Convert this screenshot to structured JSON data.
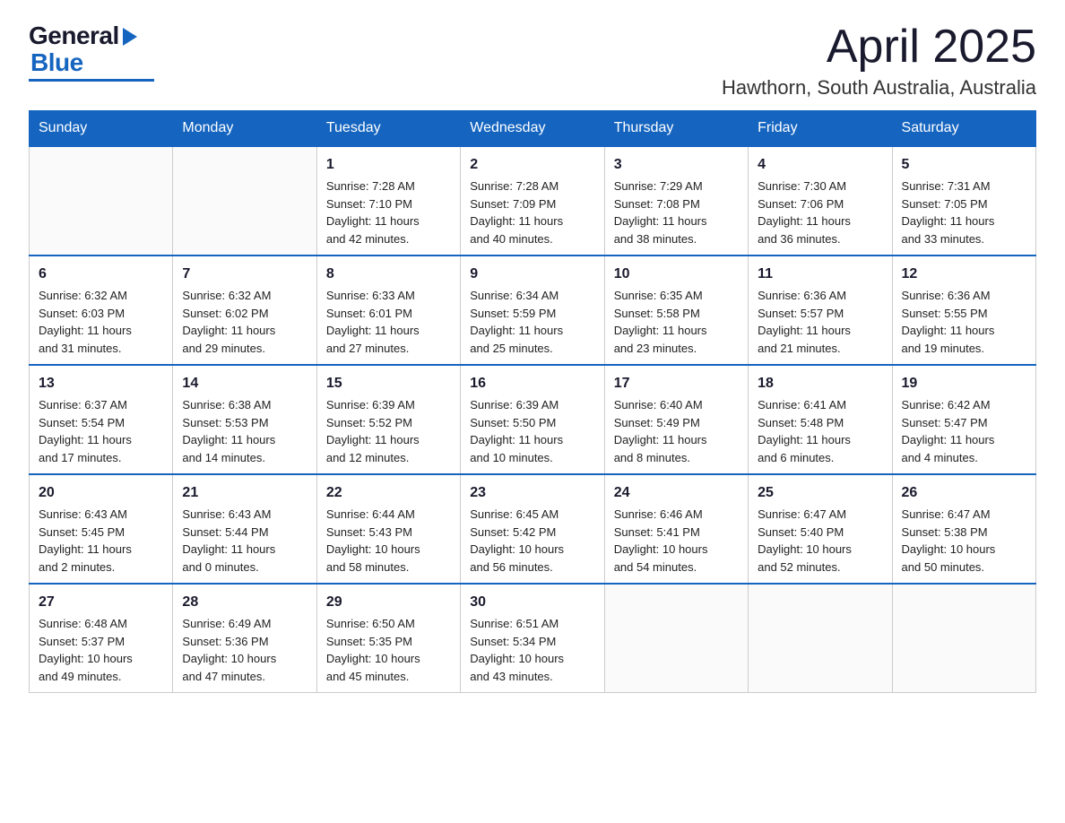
{
  "header": {
    "logo": {
      "general": "General",
      "blue": "Blue"
    },
    "title": "April 2025",
    "location": "Hawthorn, South Australia, Australia"
  },
  "calendar": {
    "days_of_week": [
      "Sunday",
      "Monday",
      "Tuesday",
      "Wednesday",
      "Thursday",
      "Friday",
      "Saturday"
    ],
    "weeks": [
      [
        {
          "day": "",
          "info": ""
        },
        {
          "day": "",
          "info": ""
        },
        {
          "day": "1",
          "info": "Sunrise: 7:28 AM\nSunset: 7:10 PM\nDaylight: 11 hours\nand 42 minutes."
        },
        {
          "day": "2",
          "info": "Sunrise: 7:28 AM\nSunset: 7:09 PM\nDaylight: 11 hours\nand 40 minutes."
        },
        {
          "day": "3",
          "info": "Sunrise: 7:29 AM\nSunset: 7:08 PM\nDaylight: 11 hours\nand 38 minutes."
        },
        {
          "day": "4",
          "info": "Sunrise: 7:30 AM\nSunset: 7:06 PM\nDaylight: 11 hours\nand 36 minutes."
        },
        {
          "day": "5",
          "info": "Sunrise: 7:31 AM\nSunset: 7:05 PM\nDaylight: 11 hours\nand 33 minutes."
        }
      ],
      [
        {
          "day": "6",
          "info": "Sunrise: 6:32 AM\nSunset: 6:03 PM\nDaylight: 11 hours\nand 31 minutes."
        },
        {
          "day": "7",
          "info": "Sunrise: 6:32 AM\nSunset: 6:02 PM\nDaylight: 11 hours\nand 29 minutes."
        },
        {
          "day": "8",
          "info": "Sunrise: 6:33 AM\nSunset: 6:01 PM\nDaylight: 11 hours\nand 27 minutes."
        },
        {
          "day": "9",
          "info": "Sunrise: 6:34 AM\nSunset: 5:59 PM\nDaylight: 11 hours\nand 25 minutes."
        },
        {
          "day": "10",
          "info": "Sunrise: 6:35 AM\nSunset: 5:58 PM\nDaylight: 11 hours\nand 23 minutes."
        },
        {
          "day": "11",
          "info": "Sunrise: 6:36 AM\nSunset: 5:57 PM\nDaylight: 11 hours\nand 21 minutes."
        },
        {
          "day": "12",
          "info": "Sunrise: 6:36 AM\nSunset: 5:55 PM\nDaylight: 11 hours\nand 19 minutes."
        }
      ],
      [
        {
          "day": "13",
          "info": "Sunrise: 6:37 AM\nSunset: 5:54 PM\nDaylight: 11 hours\nand 17 minutes."
        },
        {
          "day": "14",
          "info": "Sunrise: 6:38 AM\nSunset: 5:53 PM\nDaylight: 11 hours\nand 14 minutes."
        },
        {
          "day": "15",
          "info": "Sunrise: 6:39 AM\nSunset: 5:52 PM\nDaylight: 11 hours\nand 12 minutes."
        },
        {
          "day": "16",
          "info": "Sunrise: 6:39 AM\nSunset: 5:50 PM\nDaylight: 11 hours\nand 10 minutes."
        },
        {
          "day": "17",
          "info": "Sunrise: 6:40 AM\nSunset: 5:49 PM\nDaylight: 11 hours\nand 8 minutes."
        },
        {
          "day": "18",
          "info": "Sunrise: 6:41 AM\nSunset: 5:48 PM\nDaylight: 11 hours\nand 6 minutes."
        },
        {
          "day": "19",
          "info": "Sunrise: 6:42 AM\nSunset: 5:47 PM\nDaylight: 11 hours\nand 4 minutes."
        }
      ],
      [
        {
          "day": "20",
          "info": "Sunrise: 6:43 AM\nSunset: 5:45 PM\nDaylight: 11 hours\nand 2 minutes."
        },
        {
          "day": "21",
          "info": "Sunrise: 6:43 AM\nSunset: 5:44 PM\nDaylight: 11 hours\nand 0 minutes."
        },
        {
          "day": "22",
          "info": "Sunrise: 6:44 AM\nSunset: 5:43 PM\nDaylight: 10 hours\nand 58 minutes."
        },
        {
          "day": "23",
          "info": "Sunrise: 6:45 AM\nSunset: 5:42 PM\nDaylight: 10 hours\nand 56 minutes."
        },
        {
          "day": "24",
          "info": "Sunrise: 6:46 AM\nSunset: 5:41 PM\nDaylight: 10 hours\nand 54 minutes."
        },
        {
          "day": "25",
          "info": "Sunrise: 6:47 AM\nSunset: 5:40 PM\nDaylight: 10 hours\nand 52 minutes."
        },
        {
          "day": "26",
          "info": "Sunrise: 6:47 AM\nSunset: 5:38 PM\nDaylight: 10 hours\nand 50 minutes."
        }
      ],
      [
        {
          "day": "27",
          "info": "Sunrise: 6:48 AM\nSunset: 5:37 PM\nDaylight: 10 hours\nand 49 minutes."
        },
        {
          "day": "28",
          "info": "Sunrise: 6:49 AM\nSunset: 5:36 PM\nDaylight: 10 hours\nand 47 minutes."
        },
        {
          "day": "29",
          "info": "Sunrise: 6:50 AM\nSunset: 5:35 PM\nDaylight: 10 hours\nand 45 minutes."
        },
        {
          "day": "30",
          "info": "Sunrise: 6:51 AM\nSunset: 5:34 PM\nDaylight: 10 hours\nand 43 minutes."
        },
        {
          "day": "",
          "info": ""
        },
        {
          "day": "",
          "info": ""
        },
        {
          "day": "",
          "info": ""
        }
      ]
    ]
  }
}
